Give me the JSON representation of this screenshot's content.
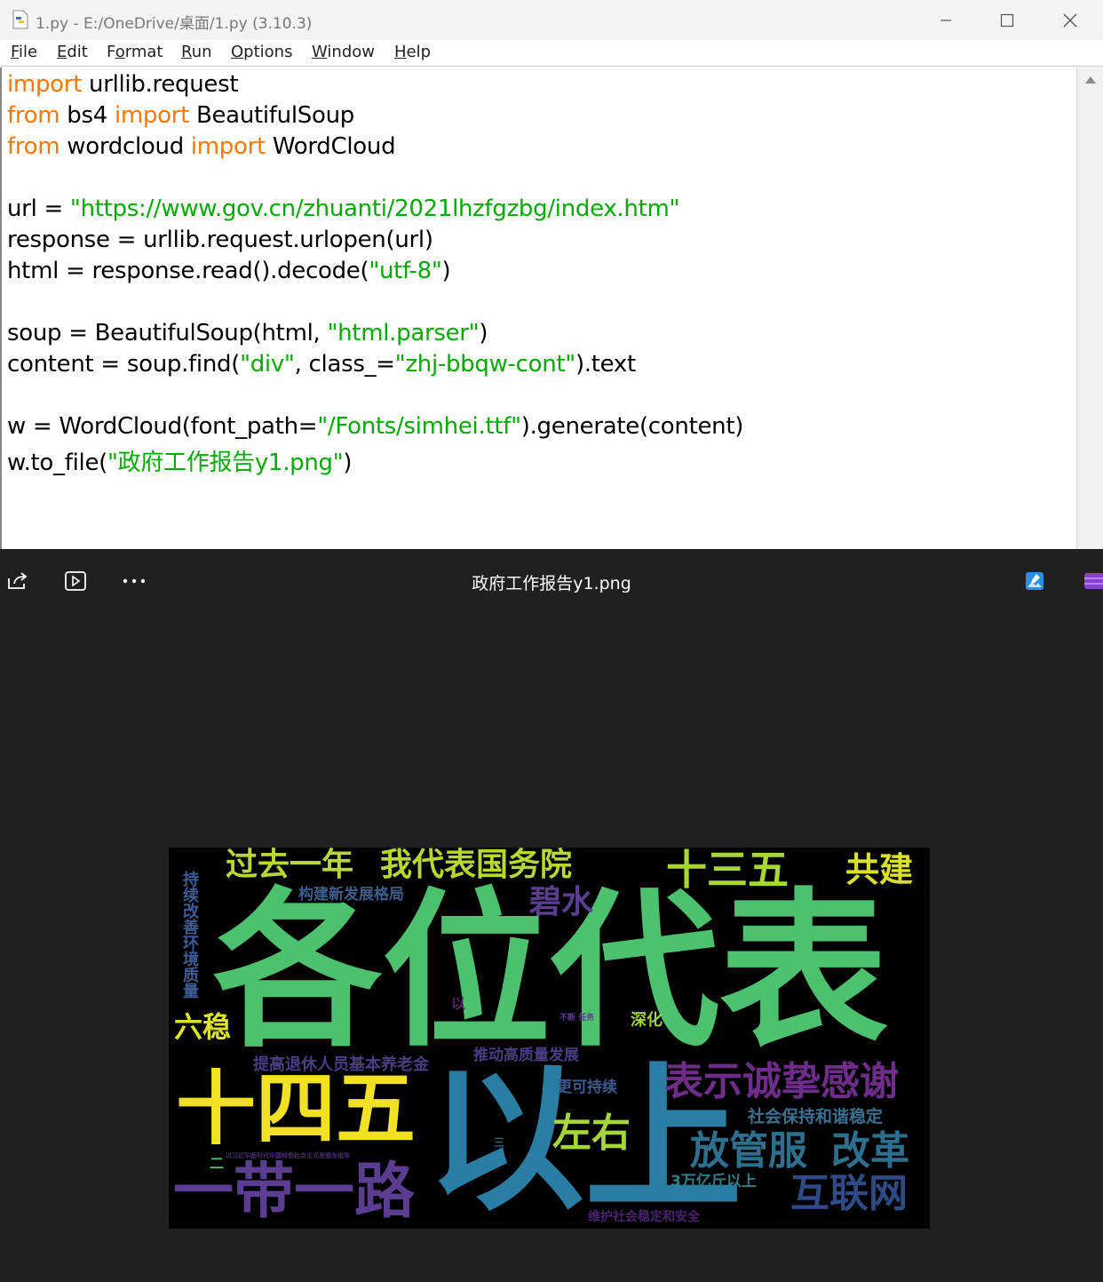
{
  "window": {
    "title": "1.py - E:/OneDrive/桌面/1.py (3.10.3)",
    "controls": [
      "minimize",
      "maximize",
      "close"
    ]
  },
  "menu": {
    "items": [
      {
        "label": "File",
        "mnemonic": "F",
        "rest": "ile"
      },
      {
        "label": "Edit",
        "mnemonic": "E",
        "rest": "dit"
      },
      {
        "label": "Format",
        "pre": "F",
        "mnemonic": "o",
        "rest": "rmat"
      },
      {
        "label": "Run",
        "mnemonic": "R",
        "rest": "un"
      },
      {
        "label": "Options",
        "mnemonic": "O",
        "rest": "ptions"
      },
      {
        "label": "Window",
        "mnemonic": "W",
        "rest": "indow"
      },
      {
        "label": "Help",
        "mnemonic": "H",
        "rest": "elp"
      }
    ]
  },
  "code": {
    "line1": {
      "kw1": "import",
      "rest": " urllib.request"
    },
    "line2": {
      "kw1": "from",
      "a": " bs4 ",
      "kw2": "import",
      "b": " BeautifulSoup"
    },
    "line3": {
      "kw1": "from",
      "a": " wordcloud ",
      "kw2": "import",
      "b": " WordCloud"
    },
    "line5": {
      "a": "url = ",
      "s1": "\"https://www.gov.cn/zhuanti/2021lhzfgzbg/index.htm\""
    },
    "line6": {
      "a": "response = urllib.request.urlopen(url)"
    },
    "line7": {
      "a": "html = response.read().decode(",
      "s1": "\"utf-8\"",
      "b": ")"
    },
    "line9": {
      "a": "soup = BeautifulSoup(html, ",
      "s1": "\"html.parser\"",
      "b": ")"
    },
    "line10": {
      "a": "content = soup.find(",
      "s1": "\"div\"",
      "b": ", class_=",
      "s2": "\"zhj-bbqw-cont\"",
      "c": ").text"
    },
    "line12": {
      "a": "w = WordCloud(font_path=",
      "s1": "\"/Fonts/simhei.ttf\"",
      "b": ").generate(content)"
    },
    "line13": {
      "a": "w.to_file(",
      "s1": "\"政府工作报告y1.png\"",
      "b": ")"
    }
  },
  "viewer": {
    "file_name": "政府工作报告y1.png",
    "toolbar_icons": [
      "share-icon",
      "slideshow-icon",
      "more-icon"
    ],
    "right_icons": [
      "edit-photo-icon",
      "clipchamp-icon"
    ]
  },
  "wordcloud": {
    "words": [
      {
        "text": "各位代表",
        "color": "#4cc26e"
      },
      {
        "text": "以上",
        "color": "#2a7ea3"
      },
      {
        "text": "十四五",
        "color": "#f2e024"
      },
      {
        "text": "一带一路",
        "color": "#5b3e91"
      },
      {
        "text": "过去一年",
        "color": "#b8d831"
      },
      {
        "text": "我代表国务院",
        "color": "#b8d831"
      },
      {
        "text": "十三五",
        "color": "#a9d834"
      },
      {
        "text": "共建",
        "color": "#d9e02a"
      },
      {
        "text": "碧水",
        "color": "#5b3e91"
      },
      {
        "text": "构建新发展格局",
        "color": "#3a5f8f"
      },
      {
        "text": "持续改善环境质量",
        "color": "#3f5c94"
      },
      {
        "text": "六稳",
        "color": "#dde326"
      },
      {
        "text": "深化",
        "color": "#9fd43c"
      },
      {
        "text": "以",
        "color": "#5b1f70"
      },
      {
        "text": "表示诚挚感谢",
        "color": "#6f2c8a"
      },
      {
        "text": "社会保持和谐稳定",
        "color": "#3b6f8f"
      },
      {
        "text": "提高退休人员基本养老金",
        "color": "#4b3c83"
      },
      {
        "text": "推动高质量发展",
        "color": "#4b3c83"
      },
      {
        "text": "更可持续",
        "color": "#3f5a8e"
      },
      {
        "text": "左右",
        "color": "#a5d63a"
      },
      {
        "text": "放管服",
        "color": "#2d6f8f"
      },
      {
        "text": "改革",
        "color": "#2d6f8f"
      },
      {
        "text": "3万亿斤以上",
        "color": "#2e7f8e"
      },
      {
        "text": "互联网",
        "color": "#2f4a86"
      },
      {
        "text": "维护社会稳定和安全",
        "color": "#4a2070"
      },
      {
        "text": "不断 任务",
        "color": "#5b3d8f"
      },
      {
        "text": "三",
        "color": "#3d5a8f"
      },
      {
        "text": "以习近平新时代中国特色社会主义思想为指导",
        "color": "#4a2a78"
      },
      {
        "text": "二",
        "color": "#4cc26e"
      }
    ]
  }
}
